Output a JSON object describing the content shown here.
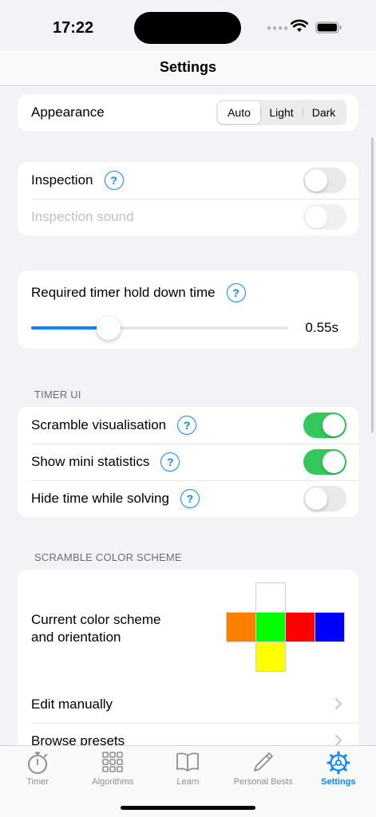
{
  "status_bar": {
    "time": "17:22"
  },
  "nav": {
    "title": "Settings"
  },
  "appearance": {
    "label": "Appearance",
    "options": [
      "Auto",
      "Light",
      "Dark"
    ],
    "selected": "Auto"
  },
  "inspection": {
    "inspection_label": "Inspection",
    "inspection_on": false,
    "sound_label": "Inspection sound",
    "sound_on": false
  },
  "hold_time": {
    "label": "Required timer hold down time",
    "value": 0.55,
    "value_text": "0.55s",
    "fraction": 0.3
  },
  "timer_ui": {
    "header": "TIMER UI",
    "items": [
      {
        "label": "Scramble visualisation",
        "on": true
      },
      {
        "label": "Show mini statistics",
        "on": true
      },
      {
        "label": "Hide time while solving",
        "on": false
      }
    ]
  },
  "color_scheme": {
    "header": "SCRAMBLE COLOR SCHEME",
    "current_label_line1": "Current color scheme",
    "current_label_line2": "and orientation",
    "faces": {
      "top": "#ffffff",
      "left": "#ff7f00",
      "front": "#00ff00",
      "right": "#ff0000",
      "back": "#0000ff",
      "bottom": "#ffff00"
    },
    "edit_label": "Edit manually",
    "presets_label": "Browse presets"
  },
  "tabs": [
    {
      "label": "Timer",
      "icon": "stopwatch-icon",
      "active": false
    },
    {
      "label": "Algorithms",
      "icon": "grid-icon",
      "active": false
    },
    {
      "label": "Learn",
      "icon": "book-icon",
      "active": false
    },
    {
      "label": "Personal Bests",
      "icon": "pencil-icon",
      "active": false
    },
    {
      "label": "Settings",
      "icon": "gear-icon",
      "active": true
    }
  ],
  "colors": {
    "accent": "#0a84ff",
    "toggle_on": "#34c759",
    "background": "#f2f2f7"
  }
}
